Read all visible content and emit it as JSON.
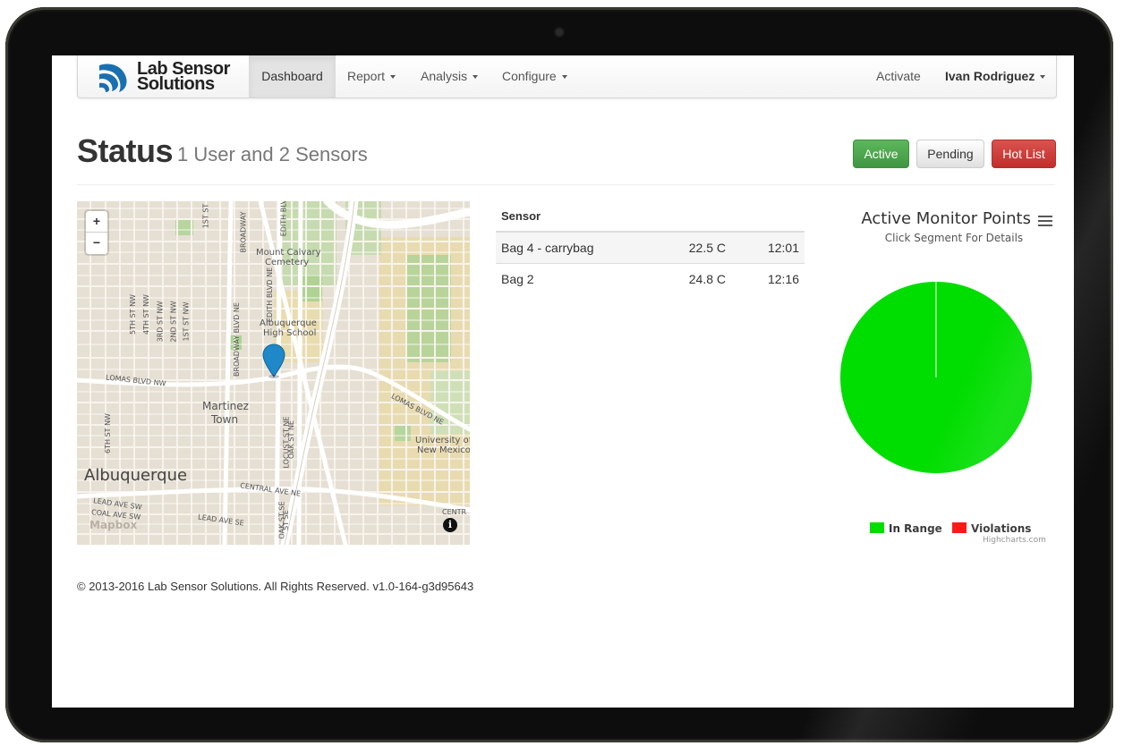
{
  "brand": {
    "line1": "Lab Sensor",
    "line2": "Solutions",
    "logo_icon": "wave-logo-icon",
    "color": "#1a6fb0"
  },
  "nav": {
    "dashboard": "Dashboard",
    "report": "Report",
    "analysis": "Analysis",
    "configure": "Configure",
    "activate": "Activate",
    "user": "Ivan Rodriguez"
  },
  "header": {
    "title": "Status",
    "subtitle": "1 User and 2 Sensors"
  },
  "buttons": {
    "active": "Active",
    "pending": "Pending",
    "hot_list": "Hot List"
  },
  "map": {
    "zoom_in": "+",
    "zoom_out": "−",
    "info": "i",
    "labels": {
      "mount_calvary_1": "Mount Calvary",
      "mount_calvary_2": "Cemetery",
      "abq_hs_1": "Albuquerque",
      "abq_hs_2": "High School",
      "martinez_1": "Martinez",
      "martinez_2": "Town",
      "unm_1": "University of",
      "unm_2": "New Mexico",
      "albuquerque": "Albuquerque",
      "mapbox": "Mapbox",
      "lomas_w": "LOMAS BLVD NW",
      "lomas_e": "LOMAS BLVD NE",
      "central": "CENTRAL AVE NE",
      "lead_sw": "LEAD AVE SW",
      "coal_sw": "COAL AVE SW",
      "lead_se": "LEAD AVE SE",
      "centr": "CENTR",
      "broadway_blvd": "BROADWAY BLVD NE",
      "broadway": "BROADWAY",
      "edith_blvd": "EDITH BLVD NE",
      "edith": "EDITH BLV",
      "first_st": "1ST ST",
      "first_st_nw": "1ST ST NW",
      "second_st": "2ND ST NW",
      "third_st": "3RD ST NW",
      "fourth_st": "4TH ST NW",
      "fifth_st": "5TH ST NW",
      "sixth_st": "6TH ST NW",
      "locust": "LOCUST ST NE",
      "oak_ne": "OAK ST NE",
      "oak_se": "OAK ST SE",
      "st_se": "ST SE"
    },
    "marker_color": "#1e88c8"
  },
  "table": {
    "header": "Sensor",
    "rows": [
      {
        "name": "Bag 4 - carrybag",
        "temp": "22.5 C",
        "time": "12:01"
      },
      {
        "name": "Bag 2",
        "temp": "24.8 C",
        "time": "12:16"
      }
    ]
  },
  "chart_data": {
    "type": "pie",
    "title": "Active Monitor Points",
    "subtitle": "Click Segment For Details",
    "slices": [
      {
        "name": "In Range",
        "value": 100,
        "color": "#00dd00"
      },
      {
        "name": "Violations",
        "value": 0,
        "color": "#ff0000"
      }
    ],
    "legend_position": "bottom",
    "credits": "Highcharts.com"
  },
  "footer": "© 2013-2016 Lab Sensor Solutions. All Rights Reserved. v1.0-164-g3d95643"
}
